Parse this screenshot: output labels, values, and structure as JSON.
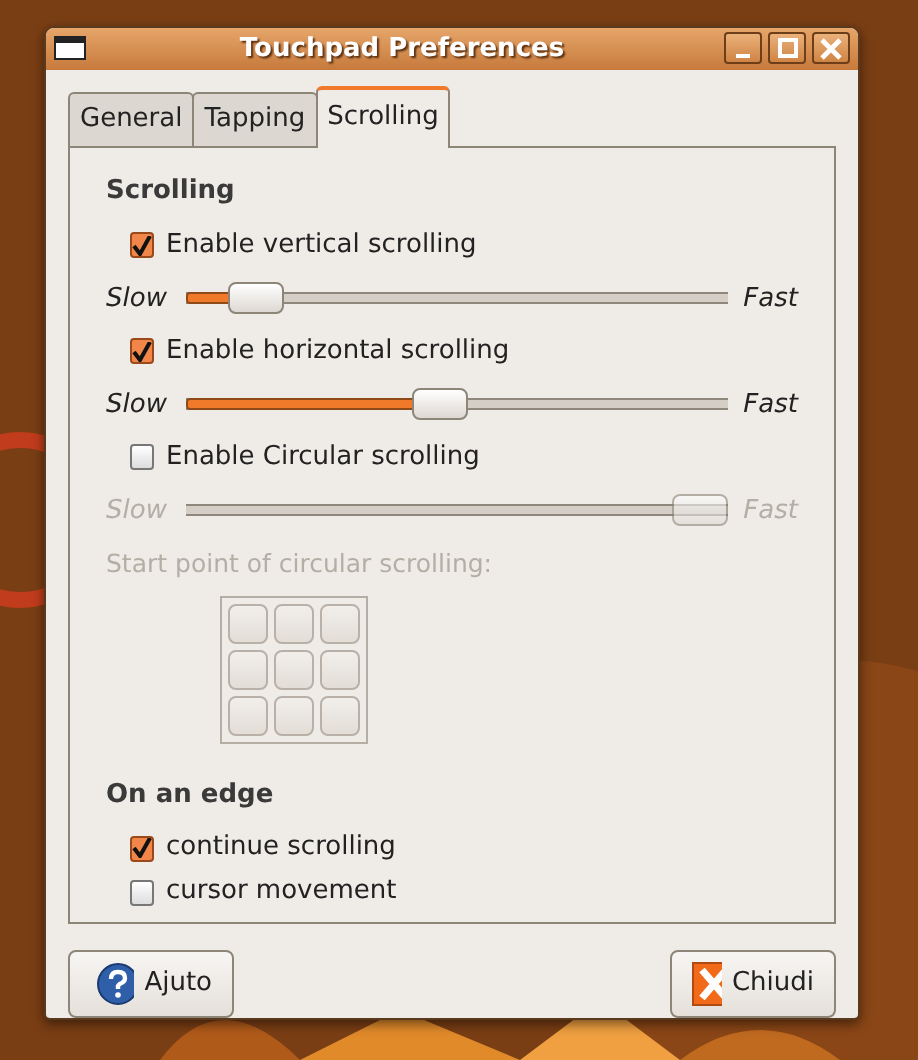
{
  "window": {
    "title": "Touchpad Preferences"
  },
  "tabs": [
    {
      "label": "General",
      "selected": false
    },
    {
      "label": "Tapping",
      "selected": false
    },
    {
      "label": "Scrolling",
      "selected": true
    }
  ],
  "sections": [
    {
      "heading": "Scrolling",
      "items": [
        {
          "kind": "checkbox",
          "label": "Enable vertical scrolling",
          "checked": true
        },
        {
          "kind": "slider",
          "min_label": "Slow",
          "max_label": "Fast",
          "level": 0.13,
          "disabled": false
        },
        {
          "kind": "checkbox",
          "label": "Enable horizontal scrolling",
          "checked": true
        },
        {
          "kind": "slider",
          "min_label": "Slow",
          "max_label": "Fast",
          "level": 0.47,
          "disabled": false
        },
        {
          "kind": "checkbox",
          "label": "Enable Circular scrolling",
          "checked": false
        },
        {
          "kind": "slider",
          "min_label": "Slow",
          "max_label": "Fast",
          "disabled": true
        },
        {
          "kind": "caption",
          "text": "Start point of circular scrolling:",
          "disabled": true
        },
        {
          "kind": "grid",
          "disabled": true
        }
      ]
    },
    {
      "heading": "On an edge",
      "items": [
        {
          "kind": "checkbox",
          "label": "continue scrolling",
          "checked": true
        },
        {
          "kind": "checkbox",
          "label": "cursor movement",
          "checked": false
        }
      ]
    }
  ],
  "buttons": [
    {
      "kind": "help",
      "label": "Ajuto"
    },
    {
      "kind": "close",
      "label": "Chiudi"
    }
  ]
}
